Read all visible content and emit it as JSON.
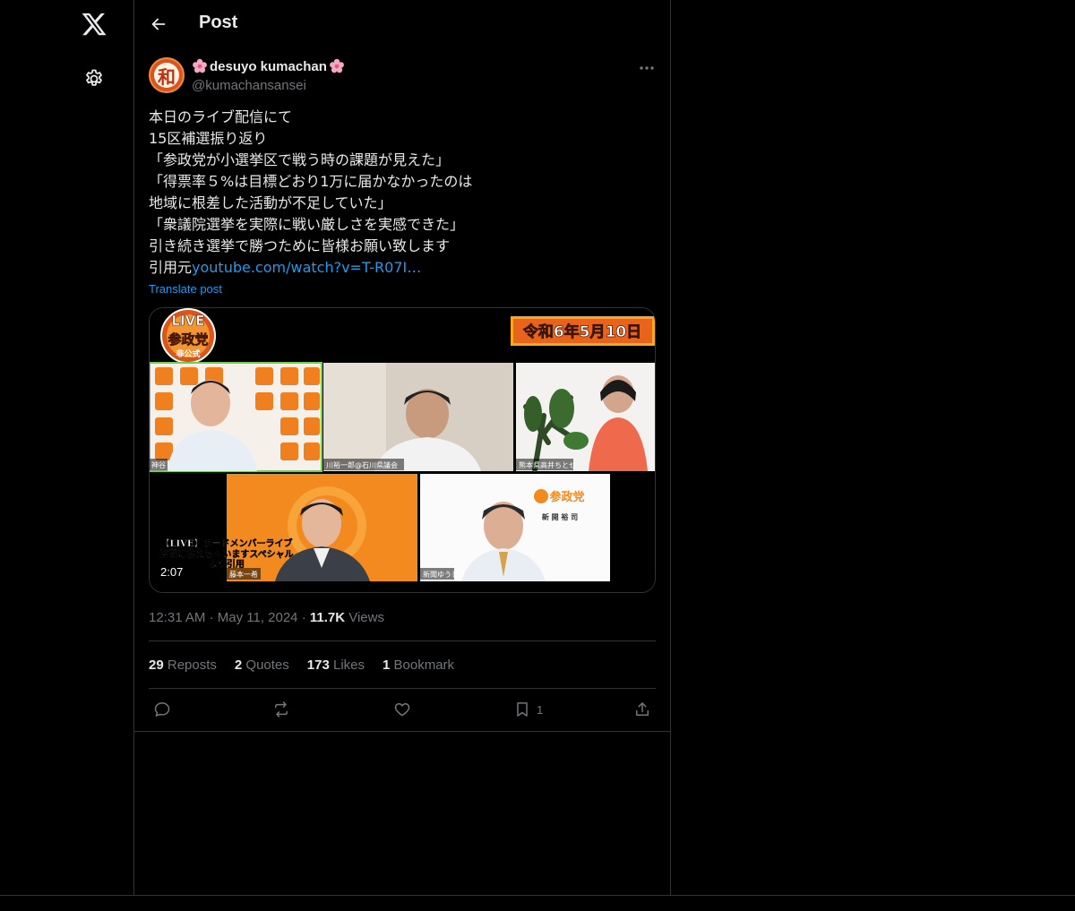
{
  "header": {
    "title": "Post"
  },
  "author": {
    "display_name": "desuyo kumachan",
    "handle": "@kumachansansei",
    "avatar_glyph": "和"
  },
  "post": {
    "lines": [
      "本日のライブ配信にて",
      "15区補選振り返り",
      "「参政党が小選挙区で戦う時の課題が見えた」",
      "「得票率５%は目標どおり1万に届かなかったのは",
      "地域に根差した活動が不足していた」",
      "「衆議院選挙を実際に戦い厳しさを実感できた」",
      "引き続き選挙で勝つために皆様お願い致します"
    ],
    "link_prefix": "引用元",
    "link_text": "youtube.com/watch?v=T-R07I…",
    "translate": "Translate post"
  },
  "media": {
    "date_banner": "令和6年5月10日",
    "live_badge": "LIVE",
    "party_name": "参政党",
    "badge_sub": "非公式",
    "caption_line1": "【LIVE】ボードメンバーライブ",
    "caption_line2": "質問に答えちゃいますスペシャル",
    "caption_line3": "より引用",
    "duration": "2:07",
    "tile_labels": [
      "神谷",
      "川裕一郎@石川県議会",
      "熊本県高井ちとせ",
      "藤本一希",
      "新聞ゆうじ"
    ],
    "sponsor_logo": "参政党",
    "sponsor_name": "新 開 裕 司"
  },
  "meta": {
    "time": "12:31 AM",
    "date": "May 11, 2024",
    "views_count": "11.7K",
    "views_label": "Views"
  },
  "stats": {
    "reposts_count": "29",
    "reposts_label": "Reposts",
    "quotes_count": "2",
    "quotes_label": "Quotes",
    "likes_count": "173",
    "likes_label": "Likes",
    "bookmarks_count": "1",
    "bookmarks_label": "Bookmark"
  },
  "actions": {
    "bookmark_count": "1"
  },
  "colors": {
    "accent": "#1d9bf0",
    "muted": "#71767b",
    "border": "#2f3336",
    "text": "#e7e9ea"
  }
}
